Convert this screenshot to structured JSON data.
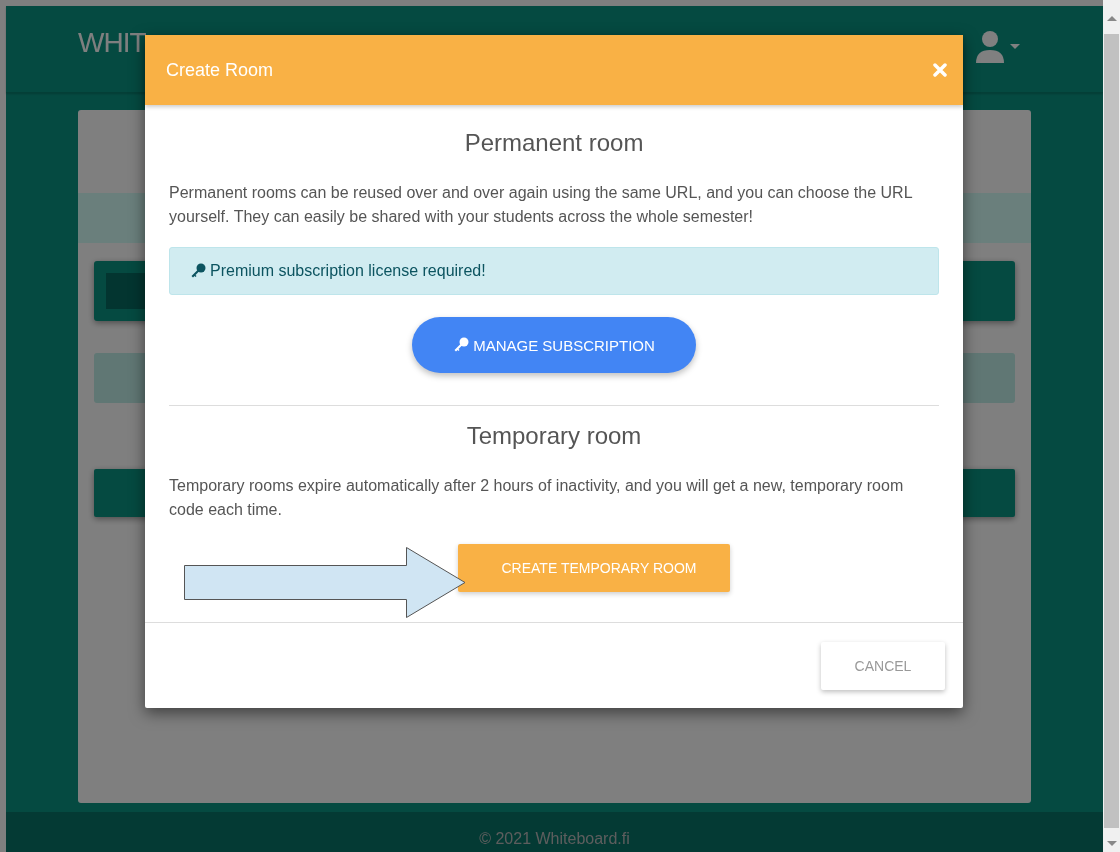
{
  "page": {
    "logo": "WHIT",
    "footer": "© 2021 Whiteboard.fi"
  },
  "dialog": {
    "title": "Create Room",
    "permanent": {
      "heading": "Permanent room",
      "text": "Permanent rooms can be reused over and over again using the same URL, and you can choose the URL yourself. They can easily be shared with your students across the whole semester!",
      "alert": "Premium subscription license required!",
      "button": "MANAGE SUBSCRIPTION"
    },
    "temporary": {
      "heading": "Temporary room",
      "text": "Temporary rooms expire automatically after 2 hours of inactivity, and you will get a new, temporary room code each time.",
      "button": "CREATE TEMPORARY ROOM"
    },
    "cancel": "CANCEL"
  }
}
